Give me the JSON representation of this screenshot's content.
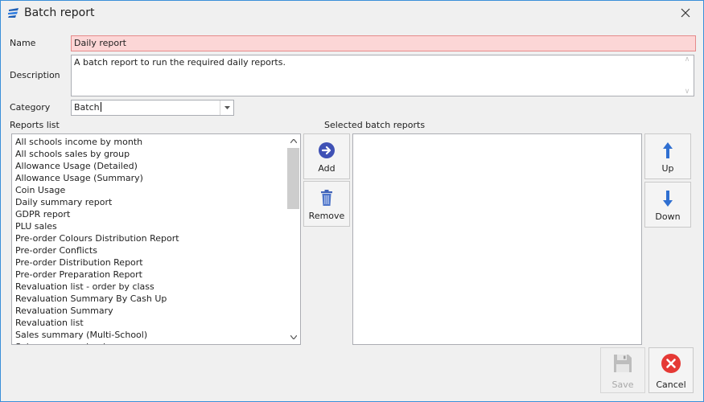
{
  "window": {
    "title": "Batch report"
  },
  "form": {
    "name_label": "Name",
    "name_value": "Daily report",
    "description_label": "Description",
    "description_value": "A batch report to run the required daily reports.",
    "category_label": "Category",
    "category_value": "Batch"
  },
  "reports_list": {
    "label": "Reports list",
    "items": [
      "All schools income by month",
      "All schools sales by group",
      "Allowance Usage (Detailed)",
      "Allowance Usage (Summary)",
      "Coin Usage",
      "Daily summary report",
      "GDPR report",
      "PLU sales",
      "Pre-order Colours Distribution Report",
      "Pre-order Conflicts",
      "Pre-order Distribution Report",
      "Pre-order Preparation Report",
      "Revaluation list - order by class",
      "Revaluation Summary By Cash Up",
      "Revaluation Summary",
      "Revaluation list",
      "Sales summary (Multi-School)",
      "Sales summary by day"
    ]
  },
  "selected_reports": {
    "label": "Selected batch reports",
    "items": []
  },
  "buttons": {
    "add": "Add",
    "remove": "Remove",
    "up": "Up",
    "down": "Down",
    "save": "Save",
    "cancel": "Cancel"
  },
  "colors": {
    "accent": "#3b8fd9",
    "add_icon": "#3f51b5",
    "arrow_icon": "#2f6fd1",
    "cancel_icon": "#e53935",
    "name_error_bg": "#fcd6d6"
  },
  "icons": {
    "app": "report-logo-icon",
    "close": "close-icon",
    "add": "arrow-right-circle-icon",
    "remove": "trash-icon",
    "up": "arrow-up-icon",
    "down": "arrow-down-icon",
    "save": "floppy-disk-icon",
    "cancel": "cancel-circle-icon"
  }
}
